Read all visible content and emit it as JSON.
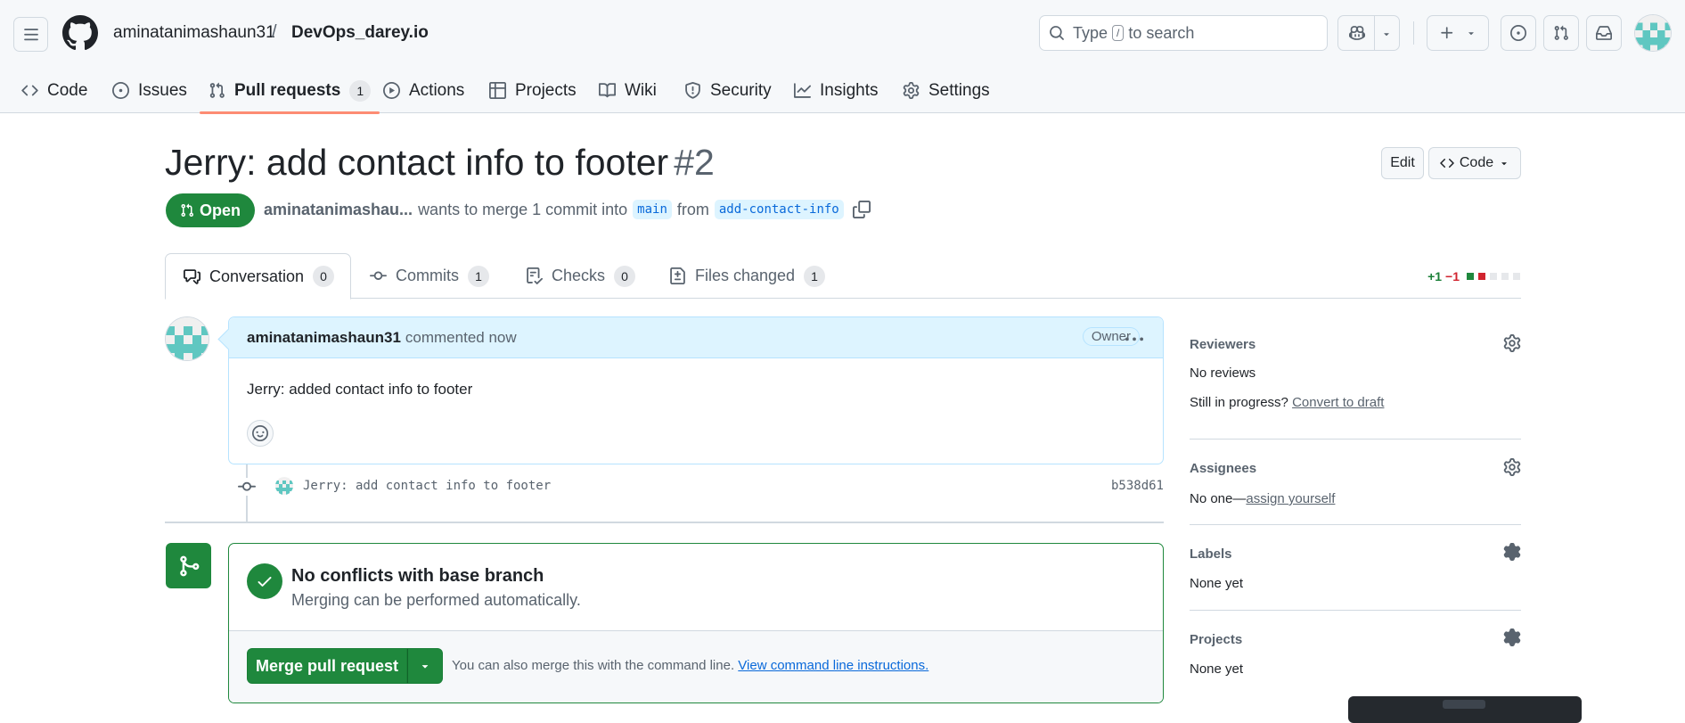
{
  "header": {
    "owner": "aminatanimashaun31",
    "separator": "/",
    "repo": "DevOps_darey.io",
    "search_prefix": "Type",
    "search_kbd": "/",
    "search_suffix": "to search"
  },
  "nav": {
    "items": [
      {
        "label": "Code",
        "icon": "code-icon"
      },
      {
        "label": "Issues",
        "icon": "issue-opened-icon"
      },
      {
        "label": "Pull requests",
        "icon": "git-pull-request-icon",
        "count": "1",
        "active": true
      },
      {
        "label": "Actions",
        "icon": "play-icon"
      },
      {
        "label": "Projects",
        "icon": "table-icon"
      },
      {
        "label": "Wiki",
        "icon": "book-icon"
      },
      {
        "label": "Security",
        "icon": "shield-icon"
      },
      {
        "label": "Insights",
        "icon": "graph-icon"
      },
      {
        "label": "Settings",
        "icon": "gear-icon"
      }
    ]
  },
  "pr": {
    "title": "Jerry: add contact info to footer",
    "number": "#2",
    "edit_label": "Edit",
    "code_label": "Code",
    "state": "Open",
    "author": "aminatanimashau...",
    "merge_text": "wants to merge 1 commit into",
    "base_branch": "main",
    "from_text": "from",
    "head_branch": "add-contact-info"
  },
  "tabs": [
    {
      "label": "Conversation",
      "count": "0"
    },
    {
      "label": "Commits",
      "count": "1"
    },
    {
      "label": "Checks",
      "count": "0"
    },
    {
      "label": "Files changed",
      "count": "1"
    }
  ],
  "diffstat": {
    "additions": "+1",
    "deletions": "−1"
  },
  "comment": {
    "author": "aminatanimashaun31",
    "time": "commented now",
    "role": "Owner",
    "body": "Jerry: added contact info to footer"
  },
  "commit": {
    "message": "Jerry: add contact info to footer",
    "sha": "b538d61"
  },
  "merge": {
    "title": "No conflicts with base branch",
    "subtitle": "Merging can be performed automatically.",
    "button": "Merge pull request",
    "hint": "You can also merge this with the command line.",
    "hint_link": "View command line instructions."
  },
  "sidebar": {
    "reviewers": {
      "heading": "Reviewers",
      "value": "No reviews",
      "draft_prefix": "Still in progress?",
      "draft_link": "Convert to draft"
    },
    "assignees": {
      "heading": "Assignees",
      "value_prefix": "No one—",
      "value_link": "assign yourself"
    },
    "labels": {
      "heading": "Labels",
      "value": "None yet"
    },
    "projects": {
      "heading": "Projects",
      "value": "None yet"
    }
  },
  "colors": {
    "accent_green": "#1f883d",
    "link_blue": "#0969da",
    "active_tab_underline": "#fd8c73",
    "comment_header_bg": "#ddf4ff"
  }
}
